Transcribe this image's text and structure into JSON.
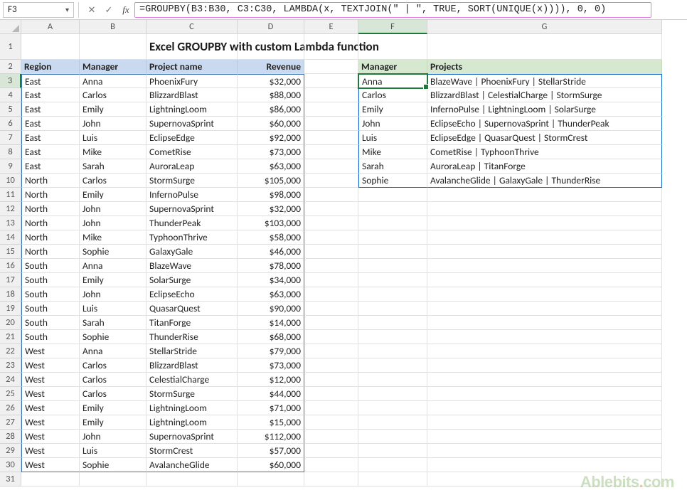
{
  "name_box": "F3",
  "formula": "=GROUPBY(B3:B30, C3:C30, LAMBDA(x, TEXTJOIN(\" | \", TRUE, SORT(UNIQUE(x)))), 0, 0)",
  "columns": [
    "A",
    "B",
    "C",
    "D",
    "E",
    "F",
    "G"
  ],
  "title": "Excel GROUPBY with custom Lambda function",
  "left_headers": [
    "Region",
    "Manager",
    "Project name",
    "Revenue"
  ],
  "right_headers": [
    "Manager",
    "Projects"
  ],
  "rows": [
    {
      "r": "East",
      "m": "Anna",
      "p": "PhoenixFury",
      "v": "$32,000"
    },
    {
      "r": "East",
      "m": "Carlos",
      "p": "BlizzardBlast",
      "v": "$88,000"
    },
    {
      "r": "East",
      "m": "Emily",
      "p": "LightningLoom",
      "v": "$86,000"
    },
    {
      "r": "East",
      "m": "John",
      "p": "SupernovaSprint",
      "v": "$60,000"
    },
    {
      "r": "East",
      "m": "Luis",
      "p": "EclipseEdge",
      "v": "$92,000"
    },
    {
      "r": "East",
      "m": "Mike",
      "p": "CometRise",
      "v": "$73,000"
    },
    {
      "r": "East",
      "m": "Sarah",
      "p": "AuroraLeap",
      "v": "$63,000"
    },
    {
      "r": "North",
      "m": "Carlos",
      "p": "StormSurge",
      "v": "$105,000"
    },
    {
      "r": "North",
      "m": "Emily",
      "p": "InfernoPulse",
      "v": "$98,000"
    },
    {
      "r": "North",
      "m": "John",
      "p": "SupernovaSprint",
      "v": "$32,000"
    },
    {
      "r": "North",
      "m": "John",
      "p": "ThunderPeak",
      "v": "$103,000"
    },
    {
      "r": "North",
      "m": "Mike",
      "p": "TyphoonThrive",
      "v": "$58,000"
    },
    {
      "r": "North",
      "m": "Sophie",
      "p": "GalaxyGale",
      "v": "$46,000"
    },
    {
      "r": "South",
      "m": "Anna",
      "p": "BlazeWave",
      "v": "$78,000"
    },
    {
      "r": "South",
      "m": "Emily",
      "p": "SolarSurge",
      "v": "$34,000"
    },
    {
      "r": "South",
      "m": "John",
      "p": "EclipseEcho",
      "v": "$63,000"
    },
    {
      "r": "South",
      "m": "Luis",
      "p": "QuasarQuest",
      "v": "$90,000"
    },
    {
      "r": "South",
      "m": "Sarah",
      "p": "TitanForge",
      "v": "$14,000"
    },
    {
      "r": "South",
      "m": "Sophie",
      "p": "ThunderRise",
      "v": "$68,000"
    },
    {
      "r": "West",
      "m": "Anna",
      "p": "StellarStride",
      "v": "$79,000"
    },
    {
      "r": "West",
      "m": "Carlos",
      "p": "BlizzardBlast",
      "v": "$73,000"
    },
    {
      "r": "West",
      "m": "Carlos",
      "p": "CelestialCharge",
      "v": "$12,000"
    },
    {
      "r": "West",
      "m": "Carlos",
      "p": "StormSurge",
      "v": "$44,000"
    },
    {
      "r": "West",
      "m": "Emily",
      "p": "LightningLoom",
      "v": "$71,000"
    },
    {
      "r": "West",
      "m": "Emily",
      "p": "LightningLoom",
      "v": "$15,000"
    },
    {
      "r": "West",
      "m": "John",
      "p": "SupernovaSprint",
      "v": "$112,000"
    },
    {
      "r": "West",
      "m": "Luis",
      "p": "StormCrest",
      "v": "$57,000"
    },
    {
      "r": "West",
      "m": "Sophie",
      "p": "AvalancheGlide",
      "v": "$60,000"
    }
  ],
  "results": [
    {
      "m": "Anna",
      "p": "BlazeWave | PhoenixFury | StellarStride"
    },
    {
      "m": "Carlos",
      "p": "BlizzardBlast | CelestialCharge | StormSurge"
    },
    {
      "m": "Emily",
      "p": "InfernoPulse | LightningLoom | SolarSurge"
    },
    {
      "m": "John",
      "p": "EclipseEcho | SupernovaSprint | ThunderPeak"
    },
    {
      "m": "Luis",
      "p": "EclipseEdge | QuasarQuest | StormCrest"
    },
    {
      "m": "Mike",
      "p": "CometRise | TyphoonThrive"
    },
    {
      "m": "Sarah",
      "p": "AuroraLeap | TitanForge"
    },
    {
      "m": "Sophie",
      "p": "AvalancheGlide | GalaxyGale | ThunderRise"
    }
  ],
  "watermark": "Ablebits.com"
}
